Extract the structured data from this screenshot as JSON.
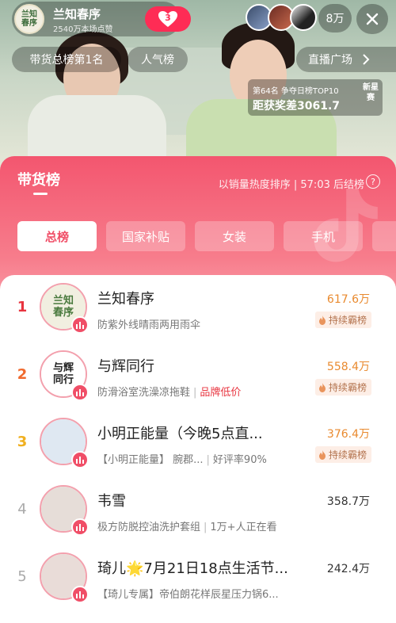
{
  "host": {
    "name": "兰知春序",
    "likes": "2540万本场点赞",
    "avatar_text": "兰知\n春序",
    "follow_count": "3"
  },
  "header": {
    "viewer_count": "8万"
  },
  "tags": {
    "sales_rank": "带货总榜第1名",
    "popularity": "人气榜",
    "plaza": "直播广场"
  },
  "rank_info": {
    "line1": "第64名  争夺日榜TOP10",
    "line2": "距获奖差3061.7",
    "badge": "新星赛"
  },
  "sheet": {
    "title": "带货榜",
    "sort_note": "以销量热度排序 | 57:03 后结榜",
    "help": "?",
    "tabs": [
      "总榜",
      "国家补贴",
      "女装",
      "手机"
    ]
  },
  "list": [
    {
      "rank": "1",
      "name": "兰知春序",
      "sub": "防紫外线晴雨两用雨伞",
      "sub_tag": "",
      "value": "617.6万",
      "streak": "持续霸榜",
      "avatar_text": "兰知\n春序",
      "rank_color": "#e8343f"
    },
    {
      "rank": "2",
      "name": "与辉同行",
      "sub": "防滑浴室洗澡凉拖鞋",
      "sub_tag": "品牌低价",
      "value": "558.4万",
      "streak": "持续霸榜",
      "avatar_text": "与辉\n同行",
      "rank_color": "#f06a2e"
    },
    {
      "rank": "3",
      "name": "小明正能量（今晚5点直...",
      "sub": "【小明正能量】 腕郡...",
      "sub_tag": "好评率90%",
      "value": "376.4万",
      "streak": "持续霸榜",
      "avatar_text": "",
      "rank_color": "#f0b020"
    },
    {
      "rank": "4",
      "name": "韦雪",
      "sub": "极方防脱控油洗护套组",
      "sub_tag": "1万+人正在看",
      "value": "358.7万",
      "streak": "",
      "avatar_text": "",
      "rank_color": "#aaaaaa"
    },
    {
      "rank": "5",
      "name": "琦儿🌟7月21日18点生活节...",
      "sub": "【琦儿专属】帝伯朗花样辰星压力锅6...",
      "sub_tag": "",
      "value": "242.4万",
      "streak": "",
      "avatar_text": "",
      "rank_color": "#aaaaaa"
    }
  ],
  "colors": {
    "accent": "#fe2c55",
    "sheet_top": "#f3566f",
    "value_gold": "#e98a2f",
    "value_default": "#333333"
  }
}
